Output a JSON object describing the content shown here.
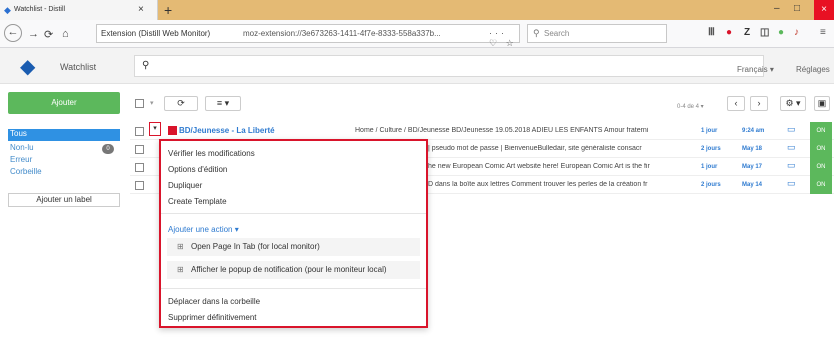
{
  "browser": {
    "tab_title": "Watchlist - Distill",
    "tab_close": "×",
    "new_tab": "+",
    "minimize": "–",
    "maximize": "□",
    "close": "×",
    "url_extension": "Extension (Distill Web Monitor)",
    "url": "moz-extension://3e673263-1411-4f7e-8333-558a337b...",
    "url_icons": "··· ♡ ☆",
    "search_placeholder": "Search",
    "icons": [
      "back-icon",
      "forward-icon",
      "reload-icon",
      "home-icon",
      "library-icon",
      "shield-icon",
      "zotero-icon",
      "reader-icon",
      "extension-icon",
      "menu-icon"
    ]
  },
  "app": {
    "title": "Watchlist",
    "language": "Français ▾",
    "settings": "Réglages",
    "add_button": "Ajouter",
    "add_label_button": "Ajouter un label",
    "sidebar": [
      {
        "label": "Tous",
        "active": true
      },
      {
        "label": "Non-lu",
        "badge": "0"
      },
      {
        "label": "Erreur"
      },
      {
        "label": "Corbeille"
      }
    ],
    "toolbar": {
      "refresh_icon": "⟳",
      "list_icon": "≡ ▾",
      "pager": "0-4 de 4 ▾",
      "prev": "‹",
      "next": "›",
      "gear": "⚙ ▾",
      "view": "▣"
    }
  },
  "rows": [
    {
      "name": "BD/Jeunesse - La Liberté",
      "text": "Home / Culture / BD/Jeunesse BD/Jeunesse 19.05.2018 ADIEU LES ENFANTS Amour fraterni",
      "age": "1 jour",
      "time": "9:24 am",
      "status": "ON"
    },
    {
      "name": "",
      "text": "| pseudo mot de passe | BienvenueBulledair, site généraliste consacr",
      "age": "2 jours",
      "time": "May 18",
      "status": "ON"
    },
    {
      "name": "",
      "text": "he new European Comic Art website here! European Comic Art is the fir",
      "age": "1 jour",
      "time": "May 17",
      "status": "ON"
    },
    {
      "name": "",
      "text": "D dans la boîte aux lettres Comment trouver les perles de la création fr",
      "age": "2 jours",
      "time": "May 14",
      "status": "ON"
    }
  ],
  "context_menu": {
    "items_top": [
      "Vérifier les modifications",
      "Options d'édition",
      "Dupliquer",
      "Create Template"
    ],
    "action_header": "Ajouter une action ▾",
    "actions": [
      "Open Page In Tab (for local monitor)",
      "Afficher le popup de notification (pour le moniteur local)"
    ],
    "items_bottom": [
      "Déplacer dans la corbeille",
      "Supprimer définitivement"
    ]
  },
  "colors": {
    "tabbar": "#e4ba74",
    "accent_blue": "#2f91e3",
    "add_green": "#5cb85c",
    "highlight_red": "#d9142b"
  }
}
